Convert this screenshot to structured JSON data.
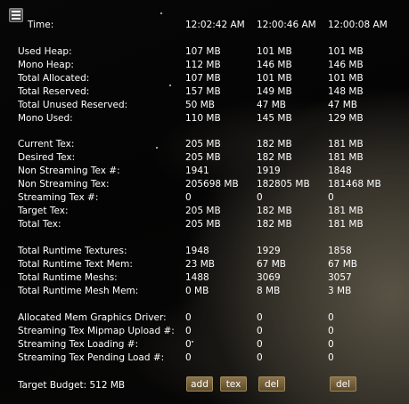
{
  "columns": {
    "time_label": "Time:",
    "times": [
      "12:02:42 AM",
      "12:00:46 AM",
      "12:00:08 AM"
    ]
  },
  "sections": [
    {
      "rows": [
        {
          "label": "Used Heap:",
          "values": [
            "107 MB",
            "101 MB",
            "101 MB"
          ]
        },
        {
          "label": "Mono Heap:",
          "values": [
            "112 MB",
            "146 MB",
            "146 MB"
          ]
        },
        {
          "label": "Total Allocated:",
          "values": [
            "107 MB",
            "101 MB",
            "101 MB"
          ]
        },
        {
          "label": "Total Reserved:",
          "values": [
            "157 MB",
            "149 MB",
            "148 MB"
          ]
        },
        {
          "label": "Total Unused Reserved:",
          "values": [
            "50 MB",
            "47 MB",
            "47 MB"
          ]
        },
        {
          "label": "Mono Used:",
          "values": [
            "110 MB",
            "145 MB",
            "129 MB"
          ]
        }
      ]
    },
    {
      "rows": [
        {
          "label": "Current Tex:",
          "values": [
            "205 MB",
            "182 MB",
            "181 MB"
          ]
        },
        {
          "label": "Desired Tex:",
          "values": [
            "205 MB",
            "182 MB",
            "181 MB"
          ]
        },
        {
          "label": "Non Streaming Tex #:",
          "values": [
            "1941",
            "1919",
            "1848"
          ]
        },
        {
          "label": "Non Streaming Tex:",
          "values": [
            "205698 MB",
            "182805 MB",
            "181468 MB"
          ]
        },
        {
          "label": "Streaming Tex #:",
          "values": [
            "0",
            "0",
            "0"
          ]
        },
        {
          "label": "Target Tex:",
          "values": [
            "205 MB",
            "182 MB",
            "181 MB"
          ]
        },
        {
          "label": "Total Tex:",
          "values": [
            "205 MB",
            "182 MB",
            "181 MB"
          ]
        }
      ]
    },
    {
      "rows": [
        {
          "label": "Total Runtime Textures:",
          "values": [
            "1948",
            "1929",
            "1858"
          ]
        },
        {
          "label": "Total Runtime Text Mem:",
          "values": [
            "23 MB",
            "67 MB",
            "67 MB"
          ]
        },
        {
          "label": "Total Runtime Meshs:",
          "values": [
            "1488",
            "3069",
            "3057"
          ]
        },
        {
          "label": "Total Runtime Mesh Mem:",
          "values": [
            "0 MB",
            "8 MB",
            "3 MB"
          ]
        }
      ]
    },
    {
      "rows": [
        {
          "label": "Allocated Mem Graphics Driver:",
          "values": [
            "0",
            "0",
            "0"
          ]
        },
        {
          "label": "Streaming Tex Mipmap Upload #:",
          "values": [
            "0",
            "0",
            "0"
          ]
        },
        {
          "label": "Streaming Tex Loading #:",
          "values": [
            "0",
            "0",
            "0"
          ]
        },
        {
          "label": "Streaming Tex Pending Load #:",
          "values": [
            "0",
            "0",
            "0"
          ]
        }
      ]
    }
  ],
  "footer": {
    "budget_label": "Target Budget: 512 MB",
    "add_label": "add",
    "tex_label": "tex",
    "del_label": "del"
  },
  "icons": {
    "menu": "hamburger-menu-icon"
  }
}
